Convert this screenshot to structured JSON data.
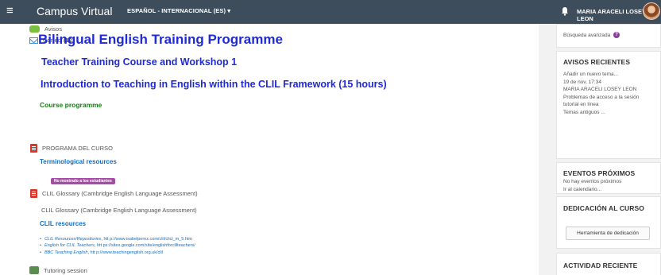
{
  "navbar": {
    "menu_icon": "menu-icon",
    "brand": "Campus Virtual",
    "language": "ESPAÑOL - INTERNACIONAL (ES) ▾",
    "bell_icon": "bell-icon",
    "user_name": "MARIA ARACELI LOSEY LEON"
  },
  "main": {
    "avisos_label": "Avisos",
    "correo_label": "Correo",
    "correo_count": "(12)",
    "title": "Bilingual English Training Programme",
    "subtitle": "Teacher Training Course and Workshop 1",
    "intro": "Introduction to Teaching in English within the CLIL Framework (15 hours)",
    "course_programme": "Course programme",
    "programa": "PROGRAMA DEL CURSO",
    "terminological": "Terminological resources",
    "hidden_badge": "No mostrado a los estudiantes",
    "glossary_link": "CLIL Glossary (Cambridge English Language Assessment)",
    "glossary_text": "CLIL Glossary (Cambridge English Language Assessment)",
    "clil_resources": "CLIL resources",
    "resources": [
      {
        "name": "CLIL Resources/Repositories",
        "url": "htt p://www.isabelperez.com/clil/clicl_m_5.htm"
      },
      {
        "name": "English for CLIL Teachers",
        "url": "htt ps://sites.google.com/site/englishforclilteachers/"
      },
      {
        "name": "BBC Teaching English",
        "url": "htt p://www.teachingenglish.org.uk/clil"
      }
    ],
    "tutoring": "Tutoring session"
  },
  "sidebar": {
    "advanced_search": "Búsqueda avanzada",
    "avisos_title": "AVISOS RECIENTES",
    "avisos_lines": [
      "Añadir un nuevo tema...",
      "19 de nov, 17:34",
      "MARIA ARACELI LOSEY LEON",
      "Problemas de acceso a la sesión",
      "tutorial en línea",
      "Temas antiguos ..."
    ],
    "eventos_title": "EVENTOS PRÓXIMOS",
    "eventos_lines": [
      "No hay eventos próximos",
      "Ir al calendario..."
    ],
    "dedicacion_title": "DEDICACIÓN AL CURSO",
    "dedicacion_button": "Herramienta de dedicación",
    "actividad_title": "ACTIVIDAD RECIENTE"
  },
  "colors": {
    "navbar": "#3d4d5c",
    "heading_blue": "#1f2ad6",
    "green_heading": "#138313",
    "link_blue": "#0f6fc5",
    "badge_purple": "#a64ca6"
  }
}
